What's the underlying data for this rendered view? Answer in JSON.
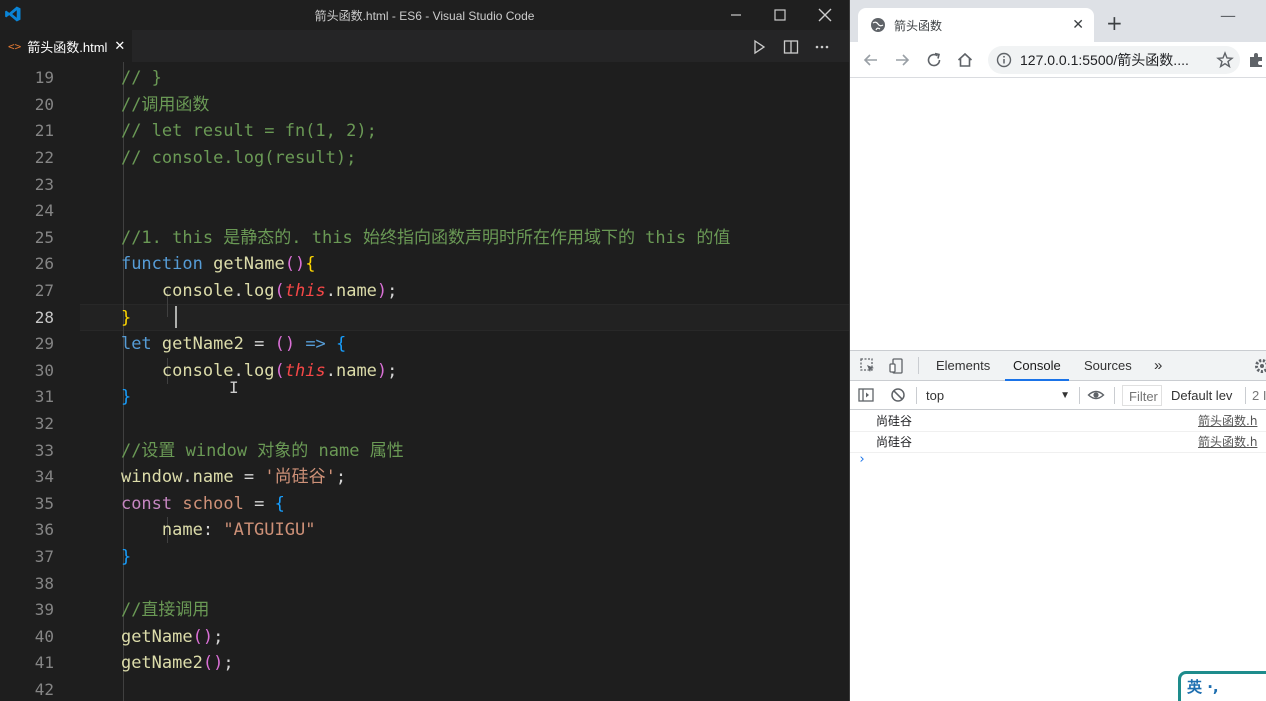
{
  "vscode": {
    "window_title": "箭头函数.html - ES6 - Visual Studio Code",
    "tab_label": "箭头函数.html",
    "tab_icon": "<>",
    "tab_close": "✕",
    "line_numbers": [
      "19",
      "20",
      "21",
      "22",
      "23",
      "24",
      "25",
      "26",
      "27",
      "28",
      "29",
      "30",
      "31",
      "32",
      "33",
      "34",
      "35",
      "36",
      "37",
      "38",
      "39",
      "40",
      "41",
      "42"
    ],
    "cursor_line": "28",
    "code": {
      "l19_comment": "// }",
      "l20_comment": "//调用函数",
      "l21_comment": "// let result = fn(1, 2);",
      "l22_comment": "// console.log(result);",
      "l25_comment": "//1. this 是静态的. this 始终指向函数声明时所在作用域下的 this 的值",
      "kw_function": "function",
      "fn_getName": "getName",
      "paren_open": "(",
      "paren_close": ")",
      "brace_open": "{",
      "brace_close": "}",
      "vr_console": "console",
      "dot": ".",
      "fn_log": "log",
      "kw_this": "this",
      "vr_name": "name",
      "semicolon": ";",
      "kw_let": "let",
      "fn_getName2": "getName2",
      "op_assign": "=",
      "arrow": "=>",
      "l33_comment": "//设置 window 对象的 name 属性",
      "vr_window": "window",
      "str_shanggugu": "'尚硅谷'",
      "kw_const": "const",
      "vr_school": "school",
      "colon": ":",
      "str_atguigu": "\"ATGUIGU\"",
      "l39_comment": "//直接调用"
    }
  },
  "browser": {
    "tab_title": "箭头函数",
    "tab_close": "✕",
    "new_tab": "+",
    "minimize": "—",
    "address": "127.0.0.1:5500/箭头函数...."
  },
  "devtools": {
    "tabs": [
      "Elements",
      "Console",
      "Sources"
    ],
    "more_tabs": "»",
    "active_tab": "Console",
    "context": "top",
    "filter_placeholder": "Filter",
    "levels": "Default lev",
    "issues": "2 I",
    "logs": [
      {
        "message": "尚硅谷",
        "source": "箭头函数.h"
      },
      {
        "message": "尚硅谷",
        "source": "箭头函数.h"
      }
    ],
    "prompt": "›"
  },
  "ime": {
    "label": "英 ·,"
  },
  "colors": {
    "editor_bg": "#1e1e1e",
    "comment": "#6a9955",
    "keyword": "#c586c0",
    "function": "#dcdcaa",
    "variable": "#9cdcfe",
    "string": "#ce9178",
    "accent": "#1a73e8"
  }
}
